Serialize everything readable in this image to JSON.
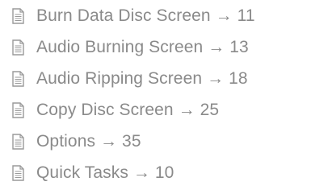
{
  "toc": {
    "items": [
      {
        "label": "Burn Data Disc Screen → 11",
        "icon": "document-icon"
      },
      {
        "label": "Audio Burning Screen → 13",
        "icon": "document-icon"
      },
      {
        "label": "Audio Ripping Screen → 18",
        "icon": "document-icon"
      },
      {
        "label": "Copy Disc Screen → 25",
        "icon": "document-icon"
      },
      {
        "label": "Options → 35",
        "icon": "document-icon"
      },
      {
        "label": "Quick Tasks → 10",
        "icon": "document-icon"
      }
    ],
    "text_color": "#8a8a8a",
    "icon_color": "#9a9a9a"
  }
}
